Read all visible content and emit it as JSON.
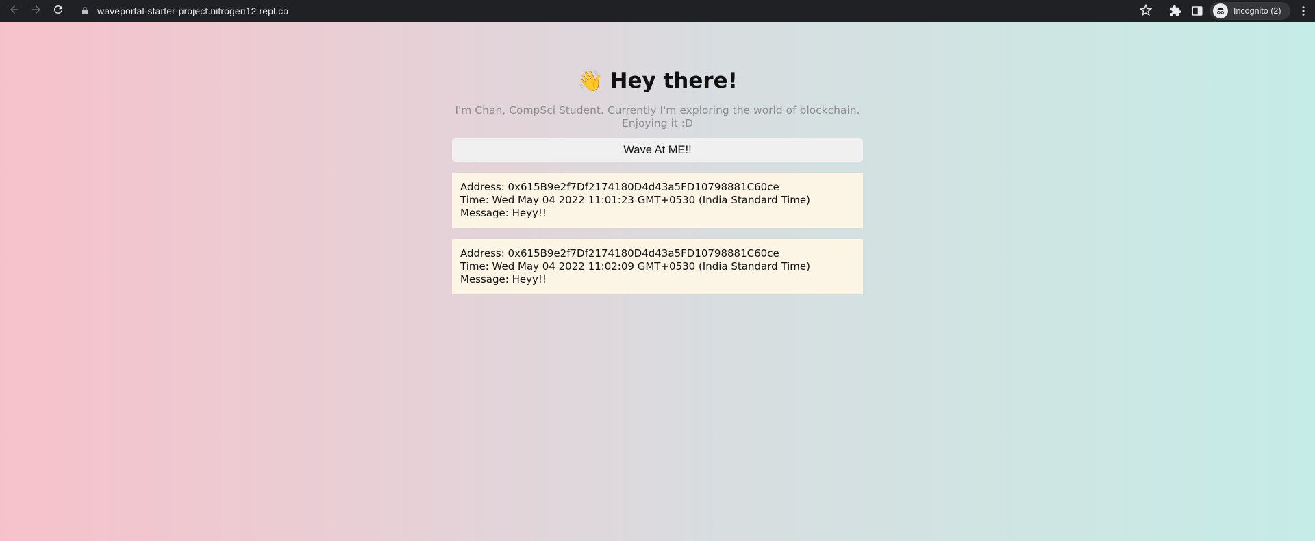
{
  "browser": {
    "url": "waveportal-starter-project.nitrogen12.repl.co",
    "profile_label": "Incognito (2)",
    "icons": {
      "back": "arrow-left-icon",
      "forward": "arrow-right-icon",
      "reload": "reload-icon",
      "lock": "lock-icon",
      "bookmark": "star-icon",
      "extensions": "puzzle-icon",
      "side_panel": "side-panel-icon",
      "incognito": "incognito-icon",
      "menu": "kebab-menu-icon"
    }
  },
  "page": {
    "header_emoji": "👋",
    "header_text": "Hey there!",
    "bio": "I'm Chan, CompSci Student. Currently I'm exploring the world of blockchain. Enjoying it :D",
    "wave_button_label": "Wave At ME!!",
    "waves": [
      {
        "address": "Address: 0x615B9e2f7Df2174180D4d43a5FD10798881C60ce",
        "time": "Time: Wed May 04 2022 11:01:23 GMT+0530 (India Standard Time)",
        "message": "Message: Heyy!!"
      },
      {
        "address": "Address: 0x615B9e2f7Df2174180D4d43a5FD10798881C60ce",
        "time": "Time: Wed May 04 2022 11:02:09 GMT+0530 (India Standard Time)",
        "message": "Message: Heyy!!"
      }
    ]
  },
  "colors": {
    "toolbar_bg": "#202124",
    "gradient_left": "#f7c1cb",
    "gradient_right": "#c5ece7",
    "card_bg": "#fcf5e5",
    "button_bg": "#f0f0f0",
    "bio_text": "#8d8d8d"
  }
}
